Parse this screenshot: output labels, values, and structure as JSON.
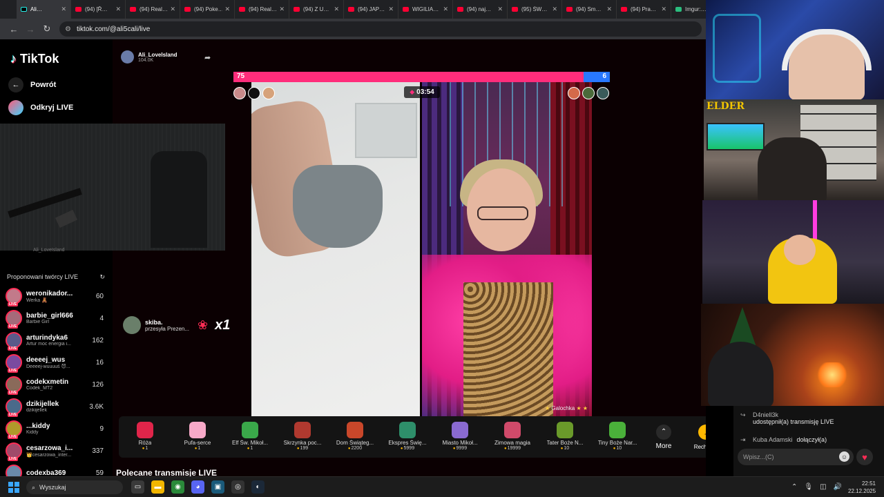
{
  "browser": {
    "tabs": [
      {
        "label": "Ali…",
        "active": true,
        "favicon": "tiktok"
      },
      {
        "label": "(94) [Ř…",
        "favicon": "youtube"
      },
      {
        "label": "(94) Real…",
        "favicon": "youtube"
      },
      {
        "label": "(94) Poke…",
        "favicon": "youtube"
      },
      {
        "label": "(94) Real…",
        "favicon": "youtube"
      },
      {
        "label": "(94) Z U…",
        "favicon": "youtube"
      },
      {
        "label": "(94) JAP…",
        "favicon": "youtube"
      },
      {
        "label": "WIGILIA…",
        "favicon": "youtube"
      },
      {
        "label": "(94) naj…",
        "favicon": "youtube"
      },
      {
        "label": "(95) ŚW…",
        "favicon": "youtube"
      },
      {
        "label": "(94) Sm…",
        "favicon": "youtube"
      },
      {
        "label": "(94) Pra…",
        "favicon": "youtube"
      },
      {
        "label": "Imgur:…",
        "favicon": "imgur"
      }
    ],
    "url": "tiktok.com/@ali5cali/live"
  },
  "sidebar": {
    "logo": "TikTok",
    "back_label": "Powrót",
    "discover_label": "Odkryj LIVE",
    "under_cam_text": "Ali_LoveIsland",
    "suggested_title": "Proponowani twórcy LIVE",
    "creators": [
      {
        "name": "weronikador...",
        "sub": "Werka 🧸",
        "count": "60"
      },
      {
        "name": "barbie_girl666",
        "sub": "Barbie Girl",
        "count": "4"
      },
      {
        "name": "arturindyka6",
        "sub": "Artur moc energia i...",
        "count": "162"
      },
      {
        "name": "deeeej_wus",
        "sub": "Deeeej-wuuuuś 😈...",
        "count": "16"
      },
      {
        "name": "codekxmetin",
        "sub": "Codek_MT2",
        "count": "126"
      },
      {
        "name": "dzikijellek",
        "sub": "dzikijellek",
        "count": "3.6K"
      },
      {
        "name": "...kiddy",
        "sub": "Kiddy",
        "count": "9"
      },
      {
        "name": "cesarzowa_i...",
        "sub": "👑cesarzowa_inter...",
        "count": "337"
      },
      {
        "name": "codexba369",
        "sub": "",
        "count": "59"
      }
    ]
  },
  "stream": {
    "host_name": "Ali_LoveIsland",
    "viewers": "104.0K",
    "battle": {
      "left_score": "75",
      "right_score": "6",
      "left_fraction": 0.93,
      "timer": "03:54",
      "right_host": "Galochka"
    },
    "gift_notice": {
      "user": "skiba.",
      "text": "przesyła Prezen...",
      "multiplier": "x1"
    }
  },
  "gifts": [
    {
      "name": "Róża",
      "price": "1",
      "color": "#e0254a"
    },
    {
      "name": "Pufa-serce",
      "price": "1",
      "color": "#f7a9c8"
    },
    {
      "name": "Elf Św. Mikoł...",
      "price": "1",
      "color": "#3aa84a"
    },
    {
      "name": "Skrzynka poc...",
      "price": "199",
      "color": "#b0392f"
    },
    {
      "name": "Dom Świąteg...",
      "price": "2200",
      "color": "#c9472a"
    },
    {
      "name": "Ekspres Świę...",
      "price": "5999",
      "color": "#2e8f6a"
    },
    {
      "name": "Miasto Mikoł...",
      "price": "9999",
      "color": "#8a6ad0"
    },
    {
      "name": "Zimowa magia",
      "price": "19999",
      "color": "#d04a6a"
    },
    {
      "name": "Tater Boże N...",
      "price": "10",
      "color": "#6a9a2a"
    },
    {
      "name": "Tiny Boże Nar...",
      "price": "10",
      "color": "#4ab03a"
    }
  ],
  "more_label": "More",
  "recharge_label": "Recharge",
  "recommended_title": "Polecane transmisje LIVE",
  "webcam_overlay": {
    "logo_text": "ELDER"
  },
  "chat": {
    "messages": [
      {
        "user": "D4niell3k",
        "text": "udostępnił(a) transmisję LIVE"
      },
      {
        "user": "Kuba Adamski",
        "text": "dołączył(a)"
      }
    ],
    "placeholder": "Wpisz...(C)"
  },
  "taskbar": {
    "search_label": "Wyszukaj",
    "time": "22:51",
    "date": "22.12.2025"
  },
  "colors": {
    "tiktok_red": "#fe2c55",
    "battle_blue": "#2878ff",
    "battle_pink": "#ff2d7b"
  }
}
